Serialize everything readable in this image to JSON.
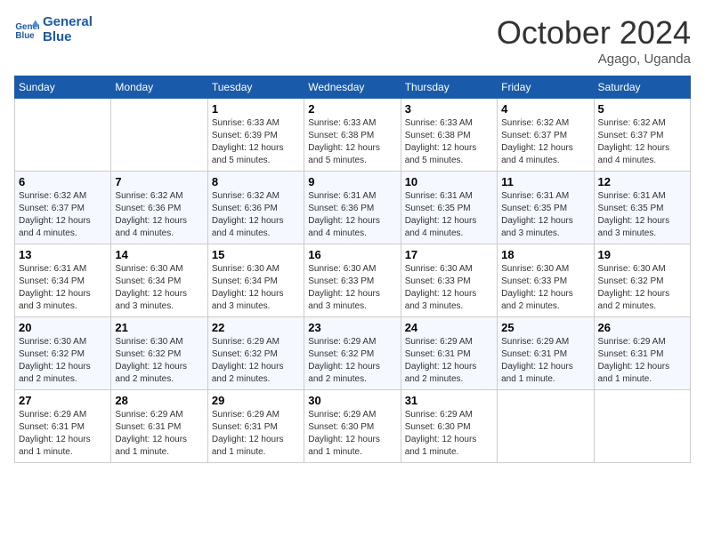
{
  "header": {
    "logo_line1": "General",
    "logo_line2": "Blue",
    "month_title": "October 2024",
    "location": "Agago, Uganda"
  },
  "days_of_week": [
    "Sunday",
    "Monday",
    "Tuesday",
    "Wednesday",
    "Thursday",
    "Friday",
    "Saturday"
  ],
  "weeks": [
    [
      {
        "day": "",
        "info": ""
      },
      {
        "day": "",
        "info": ""
      },
      {
        "day": "1",
        "info": "Sunrise: 6:33 AM\nSunset: 6:39 PM\nDaylight: 12 hours\nand 5 minutes."
      },
      {
        "day": "2",
        "info": "Sunrise: 6:33 AM\nSunset: 6:38 PM\nDaylight: 12 hours\nand 5 minutes."
      },
      {
        "day": "3",
        "info": "Sunrise: 6:33 AM\nSunset: 6:38 PM\nDaylight: 12 hours\nand 5 minutes."
      },
      {
        "day": "4",
        "info": "Sunrise: 6:32 AM\nSunset: 6:37 PM\nDaylight: 12 hours\nand 4 minutes."
      },
      {
        "day": "5",
        "info": "Sunrise: 6:32 AM\nSunset: 6:37 PM\nDaylight: 12 hours\nand 4 minutes."
      }
    ],
    [
      {
        "day": "6",
        "info": "Sunrise: 6:32 AM\nSunset: 6:37 PM\nDaylight: 12 hours\nand 4 minutes."
      },
      {
        "day": "7",
        "info": "Sunrise: 6:32 AM\nSunset: 6:36 PM\nDaylight: 12 hours\nand 4 minutes."
      },
      {
        "day": "8",
        "info": "Sunrise: 6:32 AM\nSunset: 6:36 PM\nDaylight: 12 hours\nand 4 minutes."
      },
      {
        "day": "9",
        "info": "Sunrise: 6:31 AM\nSunset: 6:36 PM\nDaylight: 12 hours\nand 4 minutes."
      },
      {
        "day": "10",
        "info": "Sunrise: 6:31 AM\nSunset: 6:35 PM\nDaylight: 12 hours\nand 4 minutes."
      },
      {
        "day": "11",
        "info": "Sunrise: 6:31 AM\nSunset: 6:35 PM\nDaylight: 12 hours\nand 3 minutes."
      },
      {
        "day": "12",
        "info": "Sunrise: 6:31 AM\nSunset: 6:35 PM\nDaylight: 12 hours\nand 3 minutes."
      }
    ],
    [
      {
        "day": "13",
        "info": "Sunrise: 6:31 AM\nSunset: 6:34 PM\nDaylight: 12 hours\nand 3 minutes."
      },
      {
        "day": "14",
        "info": "Sunrise: 6:30 AM\nSunset: 6:34 PM\nDaylight: 12 hours\nand 3 minutes."
      },
      {
        "day": "15",
        "info": "Sunrise: 6:30 AM\nSunset: 6:34 PM\nDaylight: 12 hours\nand 3 minutes."
      },
      {
        "day": "16",
        "info": "Sunrise: 6:30 AM\nSunset: 6:33 PM\nDaylight: 12 hours\nand 3 minutes."
      },
      {
        "day": "17",
        "info": "Sunrise: 6:30 AM\nSunset: 6:33 PM\nDaylight: 12 hours\nand 3 minutes."
      },
      {
        "day": "18",
        "info": "Sunrise: 6:30 AM\nSunset: 6:33 PM\nDaylight: 12 hours\nand 2 minutes."
      },
      {
        "day": "19",
        "info": "Sunrise: 6:30 AM\nSunset: 6:32 PM\nDaylight: 12 hours\nand 2 minutes."
      }
    ],
    [
      {
        "day": "20",
        "info": "Sunrise: 6:30 AM\nSunset: 6:32 PM\nDaylight: 12 hours\nand 2 minutes."
      },
      {
        "day": "21",
        "info": "Sunrise: 6:30 AM\nSunset: 6:32 PM\nDaylight: 12 hours\nand 2 minutes."
      },
      {
        "day": "22",
        "info": "Sunrise: 6:29 AM\nSunset: 6:32 PM\nDaylight: 12 hours\nand 2 minutes."
      },
      {
        "day": "23",
        "info": "Sunrise: 6:29 AM\nSunset: 6:32 PM\nDaylight: 12 hours\nand 2 minutes."
      },
      {
        "day": "24",
        "info": "Sunrise: 6:29 AM\nSunset: 6:31 PM\nDaylight: 12 hours\nand 2 minutes."
      },
      {
        "day": "25",
        "info": "Sunrise: 6:29 AM\nSunset: 6:31 PM\nDaylight: 12 hours\nand 1 minute."
      },
      {
        "day": "26",
        "info": "Sunrise: 6:29 AM\nSunset: 6:31 PM\nDaylight: 12 hours\nand 1 minute."
      }
    ],
    [
      {
        "day": "27",
        "info": "Sunrise: 6:29 AM\nSunset: 6:31 PM\nDaylight: 12 hours\nand 1 minute."
      },
      {
        "day": "28",
        "info": "Sunrise: 6:29 AM\nSunset: 6:31 PM\nDaylight: 12 hours\nand 1 minute."
      },
      {
        "day": "29",
        "info": "Sunrise: 6:29 AM\nSunset: 6:31 PM\nDaylight: 12 hours\nand 1 minute."
      },
      {
        "day": "30",
        "info": "Sunrise: 6:29 AM\nSunset: 6:30 PM\nDaylight: 12 hours\nand 1 minute."
      },
      {
        "day": "31",
        "info": "Sunrise: 6:29 AM\nSunset: 6:30 PM\nDaylight: 12 hours\nand 1 minute."
      },
      {
        "day": "",
        "info": ""
      },
      {
        "day": "",
        "info": ""
      }
    ]
  ]
}
